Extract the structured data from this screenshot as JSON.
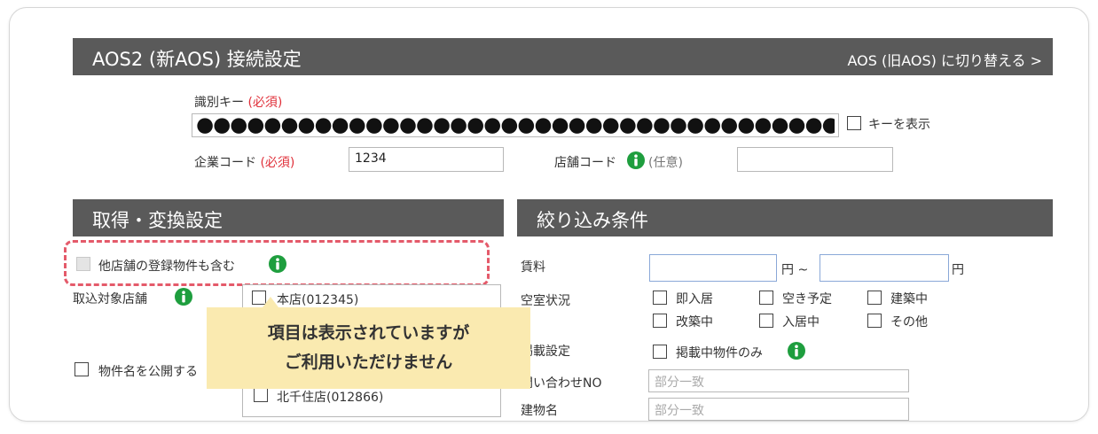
{
  "aos2": {
    "title": "AOS2 (新AOS) 接続設定",
    "switch_link": "AOS (旧AOS) に切り替える >",
    "key_label": "識別キー",
    "key_required": "(必須)",
    "key_masked": "●●●●●●●●●●●●●●●●●●●●●●●●●●●●●●●●●●●●●●",
    "show_key_label": "キーを表示",
    "company_code_label": "企業コード",
    "company_code_required": "(必須)",
    "company_code_value": "1234",
    "store_code_label": "店舗コード",
    "store_code_optional": "(任意)",
    "store_code_value": ""
  },
  "acquire": {
    "title": "取得・変換設定",
    "include_other_stores": "他店舗の登録物件も含む",
    "target_store_label": "取込対象店舗",
    "stores": [
      "本店(012345)",
      "北千住店(012866)"
    ],
    "publish_name_label": "物件名を公開する"
  },
  "filter": {
    "title": "絞り込み条件",
    "rent_label": "賃料",
    "rent_min": "",
    "rent_max": "",
    "yen_tilde": "円 ~",
    "yen": "円",
    "vacancy_label": "空室状況",
    "vacancy_options": [
      "即入居",
      "空き予定",
      "建築中",
      "改築中",
      "入居中",
      "その他"
    ],
    "listing_label": "掲載設定",
    "listing_only": "掲載中物件のみ",
    "inquiry_label": "問い合わせNO",
    "inquiry_placeholder": "部分一致",
    "building_label": "建物名",
    "building_placeholder": "部分一致"
  },
  "tooltip": {
    "line1": "項目は表示されていますが",
    "line2": "ご利用いただけません"
  },
  "colors": {
    "header_bar": "#5a5a5a",
    "required_text": "#e0303a",
    "info_icon": "#1e9e3e",
    "highlight_dash": "#e45a6a",
    "tooltip_bg": "#faeab0"
  }
}
